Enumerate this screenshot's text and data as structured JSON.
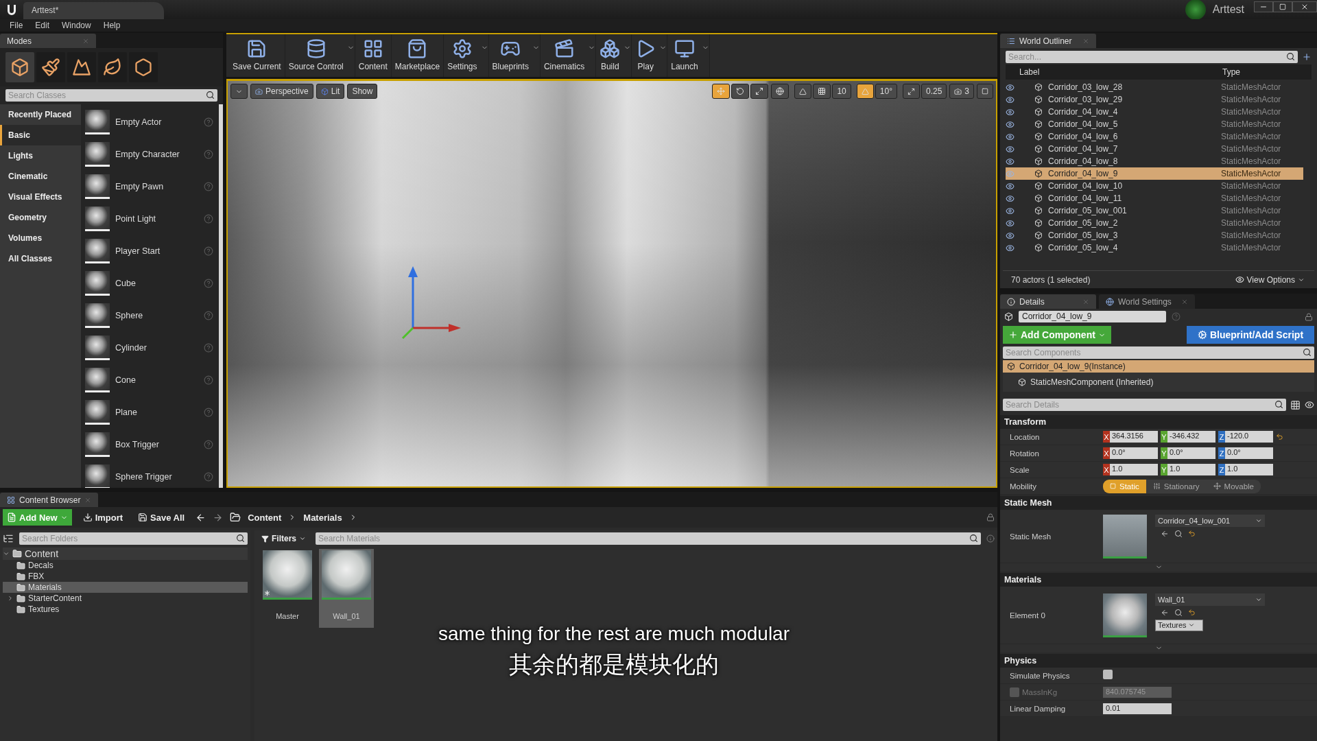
{
  "window": {
    "title": "Arttest*",
    "project": "Arttest"
  },
  "menu": [
    "File",
    "Edit",
    "Window",
    "Help"
  ],
  "modes": {
    "tab": "Modes",
    "search": {
      "placeholder": "Search Classes"
    },
    "categories": [
      {
        "label": "Recently Placed",
        "selected": false
      },
      {
        "label": "Basic",
        "selected": true
      },
      {
        "label": "Lights",
        "selected": false
      },
      {
        "label": "Cinematic",
        "selected": false
      },
      {
        "label": "Visual Effects",
        "selected": false
      },
      {
        "label": "Geometry",
        "selected": false
      },
      {
        "label": "Volumes",
        "selected": false
      },
      {
        "label": "All Classes",
        "selected": false
      }
    ],
    "items": [
      "Empty Actor",
      "Empty Character",
      "Empty Pawn",
      "Point Light",
      "Player Start",
      "Cube",
      "Sphere",
      "Cylinder",
      "Cone",
      "Plane",
      "Box Trigger",
      "Sphere Trigger"
    ]
  },
  "toolbar": [
    {
      "label": "Save Current",
      "dropdown": false
    },
    {
      "label": "Source Control",
      "dropdown": true
    },
    {
      "label": "Content",
      "dropdown": false
    },
    {
      "label": "Marketplace",
      "dropdown": false
    },
    {
      "label": "Settings",
      "dropdown": true
    },
    {
      "label": "Blueprints",
      "dropdown": true
    },
    {
      "label": "Cinematics",
      "dropdown": true
    },
    {
      "label": "Build",
      "dropdown": true
    },
    {
      "label": "Play",
      "dropdown": true
    },
    {
      "label": "Launch",
      "dropdown": true
    }
  ],
  "viewport": {
    "view_mode": "Perspective",
    "lighting": "Lit",
    "show": "Show",
    "grid_snap": "10",
    "rotation_snap": "10°",
    "scale_snap": "0.25",
    "camera_speed": "3"
  },
  "outliner": {
    "tab": "World Outliner",
    "search": {
      "placeholder": "Search..."
    },
    "columns": [
      "Label",
      "Type"
    ],
    "rows": [
      {
        "label": "Corridor_03_low_28",
        "type": "StaticMeshActor",
        "selected": false
      },
      {
        "label": "Corridor_03_low_29",
        "type": "StaticMeshActor",
        "selected": false
      },
      {
        "label": "Corridor_04_low_4",
        "type": "StaticMeshActor",
        "selected": false
      },
      {
        "label": "Corridor_04_low_5",
        "type": "StaticMeshActor",
        "selected": false
      },
      {
        "label": "Corridor_04_low_6",
        "type": "StaticMeshActor",
        "selected": false
      },
      {
        "label": "Corridor_04_low_7",
        "type": "StaticMeshActor",
        "selected": false
      },
      {
        "label": "Corridor_04_low_8",
        "type": "StaticMeshActor",
        "selected": false
      },
      {
        "label": "Corridor_04_low_9",
        "type": "StaticMeshActor",
        "selected": true
      },
      {
        "label": "Corridor_04_low_10",
        "type": "StaticMeshActor",
        "selected": false
      },
      {
        "label": "Corridor_04_low_11",
        "type": "StaticMeshActor",
        "selected": false
      },
      {
        "label": "Corridor_05_low_001",
        "type": "StaticMeshActor",
        "selected": false
      },
      {
        "label": "Corridor_05_low_2",
        "type": "StaticMeshActor",
        "selected": false
      },
      {
        "label": "Corridor_05_low_3",
        "type": "StaticMeshActor",
        "selected": false
      },
      {
        "label": "Corridor_05_low_4",
        "type": "StaticMeshActor",
        "selected": false
      }
    ],
    "status": "70 actors (1 selected)",
    "view_options": "View Options"
  },
  "details": {
    "tabs": [
      {
        "label": "Details",
        "selected": true
      },
      {
        "label": "World Settings",
        "selected": false
      }
    ],
    "actor_name": "Corridor_04_low_9",
    "add_component": "Add Component",
    "blueprint": "Blueprint/Add Script",
    "search_components": {
      "placeholder": "Search Components"
    },
    "components": [
      {
        "label": "Corridor_04_low_9(Instance)",
        "selected": true,
        "children": [
          {
            "label": "StaticMeshComponent (Inherited)",
            "selected": false
          }
        ]
      }
    ],
    "search_details": {
      "placeholder": "Search Details"
    },
    "transform": {
      "title": "Transform",
      "rows": [
        {
          "label": "Location",
          "values": [
            {
              "axis": "X",
              "value": "364.3156"
            },
            {
              "axis": "Y",
              "value": "-346.432"
            },
            {
              "axis": "Z",
              "value": "-120.0"
            }
          ]
        },
        {
          "label": "Rotation",
          "values": [
            {
              "axis": "X",
              "value": "0.0°"
            },
            {
              "axis": "Y",
              "value": "0.0°"
            },
            {
              "axis": "Z",
              "value": "0.0°"
            }
          ]
        },
        {
          "label": "Scale",
          "values": [
            {
              "axis": "X",
              "value": "1.0"
            },
            {
              "axis": "Y",
              "value": "1.0"
            },
            {
              "axis": "Z",
              "value": "1.0"
            }
          ]
        }
      ],
      "mobility": {
        "label": "Mobility",
        "options": [
          {
            "label": "Static",
            "selected": true
          },
          {
            "label": "Stationary",
            "selected": false
          },
          {
            "label": "Movable",
            "selected": false
          }
        ]
      }
    },
    "static_mesh": {
      "title": "Static Mesh",
      "label": "Static Mesh",
      "asset": "Corridor_04_low_001"
    },
    "materials": {
      "title": "Materials",
      "label": "Element 0",
      "asset": "Wall_01",
      "textures": "Textures"
    },
    "physics": {
      "title": "Physics",
      "rows": [
        {
          "kind": "checkbox",
          "label": "Simulate Physics",
          "checked": false
        },
        {
          "kind": "toggle-number",
          "label": "MassInKg",
          "checked": false,
          "value": "840.075745"
        },
        {
          "kind": "number",
          "label": "Linear Damping",
          "value": "0.01"
        }
      ]
    }
  },
  "content_browser": {
    "tab": "Content Browser",
    "add_new": "Add New",
    "import": "Import",
    "save_all": "Save All",
    "path": [
      "Content",
      "Materials"
    ],
    "search_folders": {
      "placeholder": "Search Folders"
    },
    "filters": "Filters",
    "search_assets": {
      "placeholder": "Search Materials"
    },
    "folders": [
      {
        "label": "Content",
        "expanded": true,
        "selected": false,
        "children": [
          {
            "label": "Decals",
            "selected": false
          },
          {
            "label": "FBX",
            "selected": false
          },
          {
            "label": "Materials",
            "selected": true
          },
          {
            "label": "StarterContent",
            "expanded": false,
            "selected": false
          },
          {
            "label": "Textures",
            "selected": false
          }
        ]
      }
    ],
    "assets": [
      {
        "label": "Master",
        "selected": false,
        "master": true
      },
      {
        "label": "Wall_01",
        "selected": true,
        "master": false
      }
    ]
  },
  "subtitles": [
    "same thing for the rest are much modular",
    "其余的都是模块化的"
  ]
}
